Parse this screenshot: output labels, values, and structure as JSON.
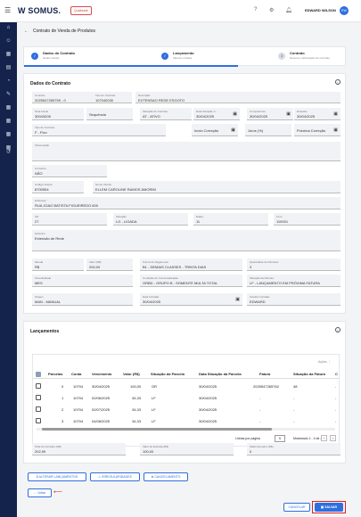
{
  "header": {
    "logo": "W SOMUS.",
    "environment_badge": "Qualidade",
    "user_name": "EDWARD WILSON",
    "avatar_initials": "EW"
  },
  "page": {
    "title": "Contrato de Venda de Produtos"
  },
  "steps": [
    {
      "title": "Dados do Contrato",
      "subtitle": "Dados Gerais",
      "mark": "✓"
    },
    {
      "title": "Lançamento",
      "subtitle": "Valores e Datas",
      "mark": "✓"
    },
    {
      "title": "Contrato",
      "subtitle": "Resumo e Efetivação do Contrato",
      "mark": "3"
    }
  ],
  "dados": {
    "title": "Dados do Contrato",
    "contrato": {
      "label": "Contrato",
      "value": "2025547265759 - 0"
    },
    "tipo_contrato_code": {
      "label": "Tipo do Contrato",
      "value": "107040030"
    },
    "descricao": {
      "label": "Descrição",
      "value": "EXTENSAO REDE ESGOTO"
    },
    "nota_fiscal": {
      "label": "Nota Fiscal",
      "value": "30043205"
    },
    "sequencia": {
      "label": "",
      "value": "Sequência"
    },
    "situacao": {
      "label": "Situação do Contrato",
      "value": "AT - ATIVO"
    },
    "data_situacao": {
      "label": "Data Situação C...",
      "value": "30/04/2025"
    },
    "competencia": {
      "label": "Competência",
      "value": "30/04/2025"
    },
    "emissao": {
      "label": "Emissão",
      "value": "30/04/2025"
    },
    "tipo_contrato": {
      "label": "Tipo de Contrato",
      "value": "F - Fixo"
    },
    "inicio_correcao": {
      "label": "",
      "value": "Início Correção"
    },
    "juros": {
      "label": "",
      "value": "Juros (%)"
    },
    "proxima_correcao": {
      "label": "",
      "value": "Próxima Correção"
    },
    "observacao": {
      "label": "Observação",
      "value": ""
    },
    "convenio": {
      "label": "Convênio",
      "value": "NÃO"
    },
    "codigo_cliente": {
      "label": "Código Cliente",
      "value": "8700554"
    },
    "nome_cliente": {
      "label": "Nome Cliente",
      "value": "ELLEM CAROLINE RAMOS AMORIM"
    },
    "endereco": {
      "label": "Endereço",
      "value": "RUA JOAO BATISTA FIGUEIREDO 600"
    },
    "ud": {
      "label": "UD",
      "value": "27"
    },
    "situacao_lig": {
      "label": "Situação",
      "value": "LG - LIGADA"
    },
    "etapa": {
      "label": "Etapa",
      "value": "11"
    },
    "livro": {
      "label": "Livro",
      "value": "110001"
    },
    "historico": {
      "label": "Histórico",
      "value": "Extensão de Rede"
    },
    "moeda": {
      "label": "Moeda",
      "value": "R$"
    },
    "valor": {
      "label": "Valor (R$)",
      "value": "200,00"
    },
    "forma_pagamento": {
      "label": "Forma de Pagamento",
      "value": "B1 - DEMAIS CLASSES - TRINTA DIAS"
    },
    "qtd_parcelas": {
      "label": "Quantidade de Parcelas",
      "value": "3"
    },
    "periodicidade": {
      "label": "Periodicidade",
      "value": "MES"
    },
    "condicao_comercializacao": {
      "label": "Condição de Comercialização",
      "value": "GRBD - GRUPO B - SOMENTE MULTA TOTAL"
    },
    "situacao_parcela": {
      "label": "Situação da Parcela",
      "value": "LF - LANÇAMENTO EM PRÓXIMA FATURA"
    },
    "origem": {
      "label": "Origem",
      "value": "MAN - MANUAL"
    },
    "data_inclusao": {
      "label": "Data Inclusão",
      "value": "30/04/2025"
    },
    "usuario_inclusao": {
      "label": "Usuário Inclusão",
      "value": "EDWARD"
    }
  },
  "lancamentos": {
    "title": "Lançamentos",
    "actions_label": "Ações",
    "columns": [
      "Parcelas",
      "Conta",
      "Vencimento",
      "Valor (R$)",
      "Situação da Parcela",
      "Data Situação da Parcela",
      "Fatura",
      "Situação da Fatura",
      "C"
    ],
    "rows": [
      [
        "0",
        "10704",
        "30/04/2025",
        "100,00",
        "GR",
        "30/04/2025",
        "2025547265762",
        "48",
        "-"
      ],
      [
        "1",
        "10704",
        "02/06/2025",
        "34,33",
        "LF",
        "30/04/2025",
        "-",
        "-",
        "-"
      ],
      [
        "2",
        "10704",
        "02/07/2025",
        "34,33",
        "LF",
        "30/04/2025",
        "-",
        "-",
        "-"
      ],
      [
        "3",
        "10704",
        "04/08/2025",
        "34,33",
        "LF",
        "30/04/2025",
        "-",
        "-",
        "-"
      ]
    ],
    "rows_per_page_label": "Linhas por página",
    "rows_per_page_value": "5",
    "range_label": "Mostrando 1 - 4 de 4",
    "total_contrato": {
      "label": "Total do Contrato (R$)",
      "value": "202,99"
    },
    "valor_entrada": {
      "label": "Valor de Entrada (R$)",
      "value": "100,00"
    },
    "saldo_devedor": {
      "label": "Saldo Devedor (R$)",
      "value": "0"
    }
  },
  "actions": {
    "alterar": "ALTERAR LANÇAMENTOS",
    "irregularidades": "IRREGULARIDADES",
    "cancelamento": "CANCELAMENTO",
    "voltar": "Voltar",
    "cancelar": "CANCELAR",
    "salvar": "SALVAR"
  },
  "colors": {
    "primary": "#2f6fde",
    "sidebar": "#14234b",
    "highlight": "#e02020"
  }
}
